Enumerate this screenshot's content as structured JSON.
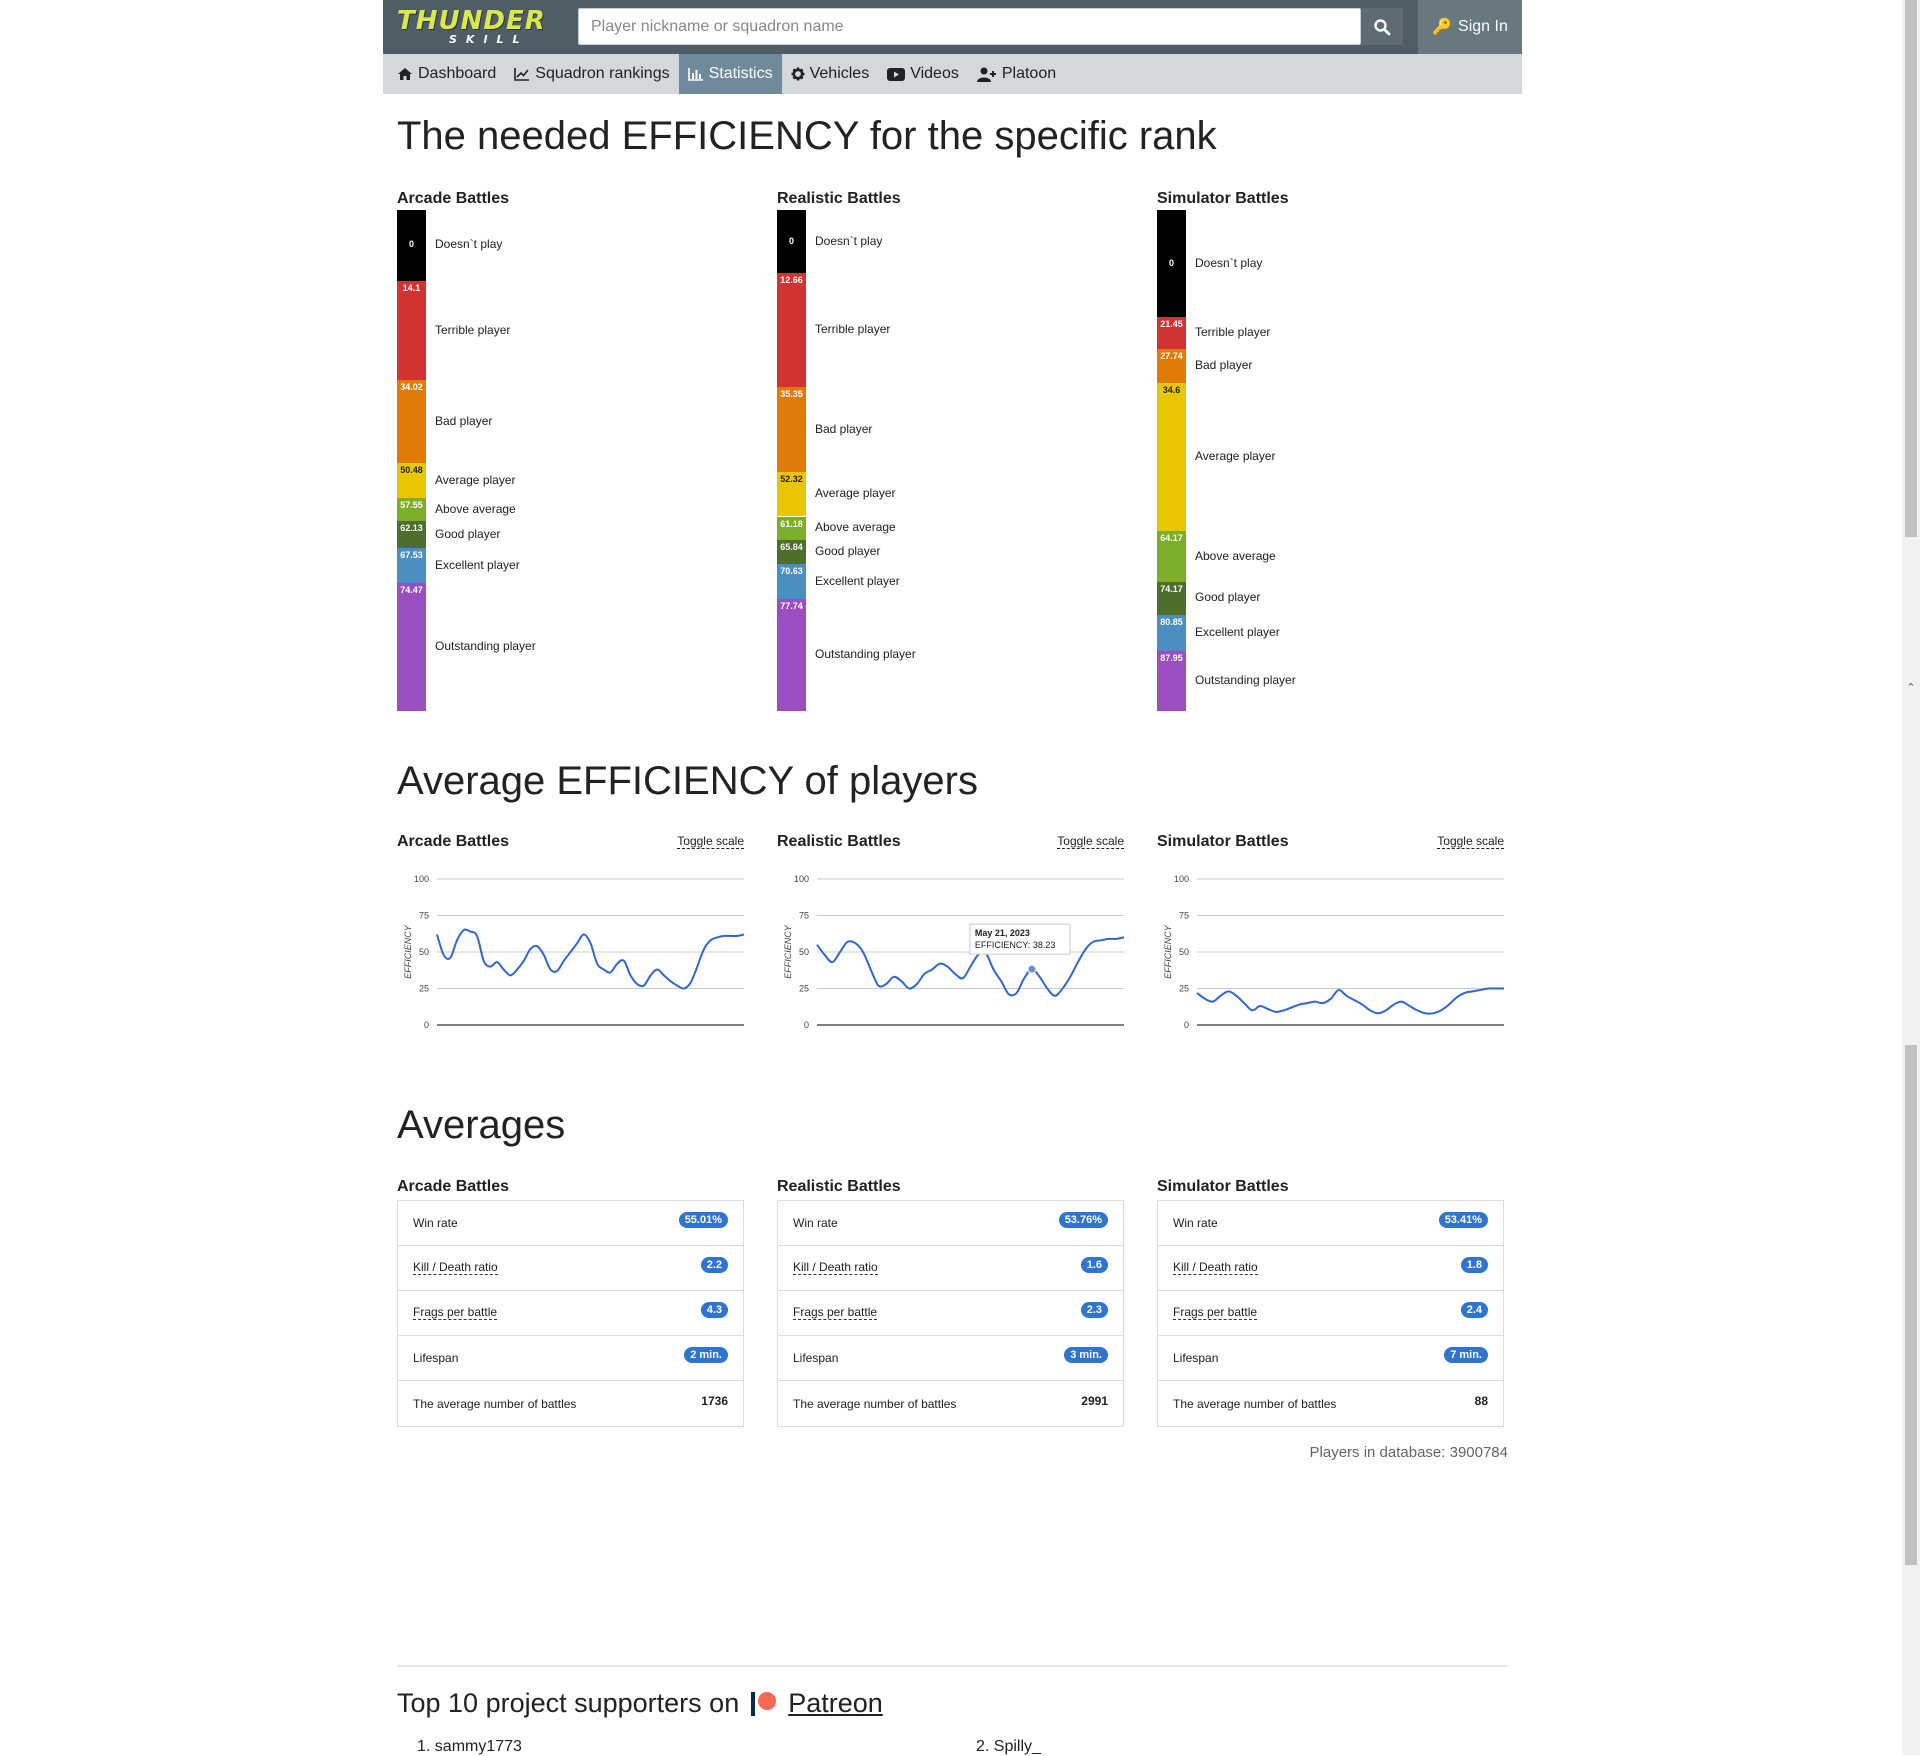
{
  "header": {
    "logo_line1": "THUNDER",
    "logo_line2": "SKILL",
    "search_placeholder": "Player nickname or squadron name",
    "sign_in": "Sign In"
  },
  "nav": [
    {
      "label": "Dashboard",
      "icon": "home-icon",
      "active": false
    },
    {
      "label": "Squadron rankings",
      "icon": "line-chart-icon",
      "active": false
    },
    {
      "label": "Statistics",
      "icon": "bar-chart-icon",
      "active": true
    },
    {
      "label": "Vehicles",
      "icon": "gear-icon",
      "active": false
    },
    {
      "label": "Videos",
      "icon": "youtube-icon",
      "active": false
    },
    {
      "label": "Platoon",
      "icon": "user-plus-icon",
      "active": false
    }
  ],
  "ranks": {
    "title": "The needed EFFICIENCY for the specific rank",
    "columns": [
      {
        "name": "Arcade Battles",
        "segments": [
          {
            "value": "0",
            "label": "Doesn`t play",
            "color": "#000000"
          },
          {
            "value": "14.1",
            "label": "Terrible player",
            "color": "#d13232"
          },
          {
            "value": "34.02",
            "label": "Bad player",
            "color": "#e07b07"
          },
          {
            "value": "50.48",
            "label": "Average player",
            "color": "#eac600"
          },
          {
            "value": "57.55",
            "label": "Above average",
            "color": "#7dae2a"
          },
          {
            "value": "62.13",
            "label": "Good player",
            "color": "#4d6e2d"
          },
          {
            "value": "67.53",
            "label": "Excellent player",
            "color": "#4a8fc2"
          },
          {
            "value": "74.47",
            "label": "Outstanding player",
            "color": "#9a4fc0"
          }
        ]
      },
      {
        "name": "Realistic Battles",
        "segments": [
          {
            "value": "0",
            "label": "Doesn`t play",
            "color": "#000000"
          },
          {
            "value": "12.66",
            "label": "Terrible player",
            "color": "#d13232"
          },
          {
            "value": "35.35",
            "label": "Bad player",
            "color": "#e07b07"
          },
          {
            "value": "52.32",
            "label": "Average player",
            "color": "#eac600"
          },
          {
            "value": "61.18",
            "label": "Above average",
            "color": "#7dae2a"
          },
          {
            "value": "65.84",
            "label": "Good player",
            "color": "#4d6e2d"
          },
          {
            "value": "70.63",
            "label": "Excellent player",
            "color": "#4a8fc2"
          },
          {
            "value": "77.74",
            "label": "Outstanding player",
            "color": "#9a4fc0"
          }
        ]
      },
      {
        "name": "Simulator Battles",
        "segments": [
          {
            "value": "0",
            "label": "Doesn`t play",
            "color": "#000000"
          },
          {
            "value": "21.45",
            "label": "Terrible player",
            "color": "#d13232"
          },
          {
            "value": "27.74",
            "label": "Bad player",
            "color": "#e07b07"
          },
          {
            "value": "34.6",
            "label": "Average player",
            "color": "#eac600"
          },
          {
            "value": "64.17",
            "label": "Above average",
            "color": "#7dae2a"
          },
          {
            "value": "74.17",
            "label": "Good player",
            "color": "#4d6e2d"
          },
          {
            "value": "80.85",
            "label": "Excellent player",
            "color": "#4a8fc2"
          },
          {
            "value": "87.95",
            "label": "Outstanding player",
            "color": "#9a4fc0"
          }
        ]
      }
    ]
  },
  "average_efficiency": {
    "title": "Average EFFICIENCY of players",
    "toggle_label": "Toggle scale",
    "tooltip": {
      "date": "May 21, 2023",
      "text": "EFFICIENCY: 38.23"
    }
  },
  "chart_data": [
    {
      "type": "line",
      "title": "Arcade Battles",
      "xlabel": "",
      "ylabel": "EFFICIENCY",
      "ylim": [
        0,
        100
      ],
      "yticks": [
        "0",
        "25",
        "50",
        "75",
        "100"
      ],
      "grid": true,
      "series": [
        {
          "values": [
            62,
            48,
            46,
            58,
            65,
            64,
            61,
            44,
            40,
            43,
            38,
            34,
            38,
            44,
            52,
            54,
            48,
            38,
            37,
            44,
            50,
            56,
            62,
            56,
            42,
            38,
            36,
            42,
            44,
            34,
            28,
            27,
            34,
            38,
            34,
            30,
            27,
            25,
            29,
            40,
            52,
            58,
            60,
            61,
            61,
            61,
            62
          ]
        }
      ]
    },
    {
      "type": "line",
      "title": "Realistic Battles",
      "xlabel": "",
      "ylabel": "EFFICIENCY",
      "ylim": [
        0,
        100
      ],
      "yticks": [
        "0",
        "25",
        "50",
        "75",
        "100"
      ],
      "grid": true,
      "series": [
        {
          "values": [
            55,
            48,
            43,
            50,
            57,
            56,
            50,
            38,
            27,
            28,
            33,
            30,
            25,
            28,
            35,
            38,
            42,
            40,
            35,
            32,
            40,
            48,
            49,
            38,
            30,
            21,
            22,
            32,
            38.23,
            33,
            25,
            20,
            25,
            33,
            43,
            52,
            57,
            58,
            59,
            59,
            60
          ]
        }
      ]
    },
    {
      "type": "line",
      "title": "Simulator Battles",
      "xlabel": "",
      "ylabel": "EFFICIENCY",
      "ylim": [
        0,
        100
      ],
      "yticks": [
        "0",
        "25",
        "50",
        "75",
        "100"
      ],
      "grid": true,
      "series": [
        {
          "values": [
            22,
            18,
            16,
            20,
            23,
            20,
            15,
            10,
            13,
            11,
            9,
            10,
            12,
            14,
            15,
            16,
            15,
            18,
            24,
            20,
            17,
            14,
            10,
            8,
            10,
            14,
            16,
            13,
            10,
            8,
            8,
            10,
            14,
            19,
            22,
            23,
            24,
            25,
            25,
            25
          ]
        }
      ]
    }
  ],
  "averages": {
    "title": "Averages",
    "columns": [
      {
        "name": "Arcade Battles",
        "rows": [
          {
            "label": "Win rate",
            "value": "55.01%",
            "badge": true,
            "dotted": false
          },
          {
            "label": "Kill / Death ratio",
            "value": "2.2",
            "badge": true,
            "dotted": true
          },
          {
            "label": "Frags per battle",
            "value": "4.3",
            "badge": true,
            "dotted": true
          },
          {
            "label": "Lifespan",
            "value": "2 min.",
            "badge": true,
            "dotted": false
          },
          {
            "label": "The average number of battles",
            "value": "1736",
            "badge": false,
            "dotted": false
          }
        ]
      },
      {
        "name": "Realistic Battles",
        "rows": [
          {
            "label": "Win rate",
            "value": "53.76%",
            "badge": true,
            "dotted": false
          },
          {
            "label": "Kill / Death ratio",
            "value": "1.6",
            "badge": true,
            "dotted": true
          },
          {
            "label": "Frags per battle",
            "value": "2.3",
            "badge": true,
            "dotted": true
          },
          {
            "label": "Lifespan",
            "value": "3 min.",
            "badge": true,
            "dotted": false
          },
          {
            "label": "The average number of battles",
            "value": "2991",
            "badge": false,
            "dotted": false
          }
        ]
      },
      {
        "name": "Simulator Battles",
        "rows": [
          {
            "label": "Win rate",
            "value": "53.41%",
            "badge": true,
            "dotted": false
          },
          {
            "label": "Kill / Death ratio",
            "value": "1.8",
            "badge": true,
            "dotted": true
          },
          {
            "label": "Frags per battle",
            "value": "2.4",
            "badge": true,
            "dotted": true
          },
          {
            "label": "Lifespan",
            "value": "7 min.",
            "badge": true,
            "dotted": false
          },
          {
            "label": "The average number of battles",
            "value": "88",
            "badge": false,
            "dotted": false
          }
        ]
      }
    ],
    "players_in_db": "Players in database: 3900784"
  },
  "patreon": {
    "title": "Top 10 project supporters on",
    "link": "Patreon",
    "supporters": [
      "1. sammy1773",
      "2. Spilly_"
    ]
  },
  "colors": {
    "topbar": "#4f5d66",
    "navbar": "#d2d8dc",
    "active_nav": "#6f8a9a",
    "badge": "#2f74d0",
    "line": "#3366cc"
  }
}
